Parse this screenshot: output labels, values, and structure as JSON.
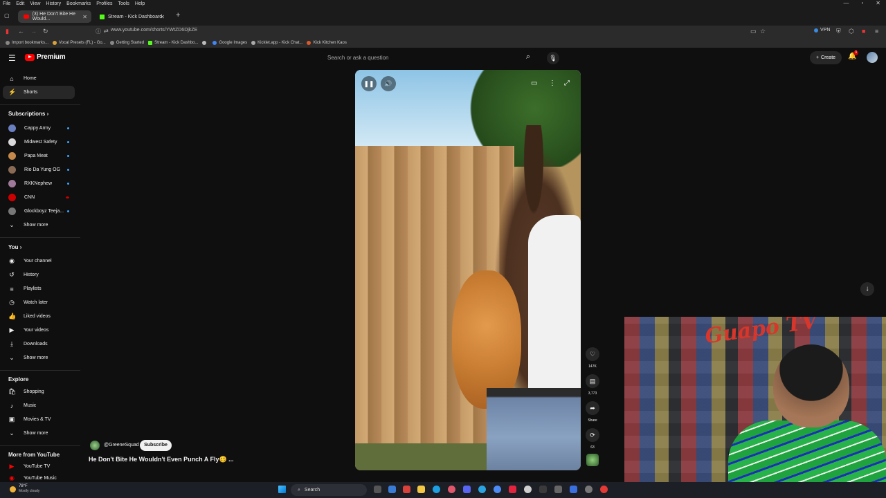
{
  "browser": {
    "menu": [
      "File",
      "Edit",
      "View",
      "History",
      "Bookmarks",
      "Profiles",
      "Tools",
      "Help"
    ],
    "tabs": [
      {
        "label": "(3) He Don't Bite He Would...",
        "active": true
      },
      {
        "label": "Stream - Kick Dashboard",
        "active": false
      }
    ],
    "new_tab": "+",
    "url": "www.youtube.com/shorts/YWtZD6DjkZE",
    "vpn_label": "VPN",
    "bookmarks": [
      "Import bookmarks...",
      "Vocal Presets (FL) - Go...",
      "Getting Started",
      "Stream - Kick Dashbo...",
      "",
      "Google Images",
      "Kicklet.app - Kick Chat...",
      "Kick Kitchen Kaos"
    ]
  },
  "header": {
    "logo_text": "Premium",
    "search_placeholder": "Search or ask a question",
    "create_label": "Create",
    "notification_count": "3"
  },
  "sidebar": {
    "main": [
      {
        "label": "Home",
        "icon": "home-icon"
      },
      {
        "label": "Shorts",
        "icon": "shorts-icon",
        "active": true
      }
    ],
    "subscriptions_title": "Subscriptions",
    "subscriptions": [
      {
        "label": "Cappy Army",
        "color": "#6a7fbf"
      },
      {
        "label": "Midwest Safety",
        "color": "#d9d9d9"
      },
      {
        "label": "Papa Meat",
        "color": "#c58a4b"
      },
      {
        "label": "Rio Da Yung OG",
        "color": "#8a6a55"
      },
      {
        "label": "RXKNephew",
        "color": "#a07a9a"
      },
      {
        "label": "CNN",
        "color": "#cc0000"
      },
      {
        "label": "Glockboyz Teeja...",
        "color": "#777777"
      }
    ],
    "show_more": "Show more",
    "you_title": "You",
    "you_items": [
      {
        "label": "Your channel",
        "icon": "account-icon"
      },
      {
        "label": "History",
        "icon": "history-icon"
      },
      {
        "label": "Playlists",
        "icon": "playlists-icon"
      },
      {
        "label": "Watch later",
        "icon": "clock-icon"
      },
      {
        "label": "Liked videos",
        "icon": "thumbs-up-icon"
      },
      {
        "label": "Your videos",
        "icon": "video-icon"
      },
      {
        "label": "Downloads",
        "icon": "download-icon"
      }
    ],
    "explore_title": "Explore",
    "explore_items": [
      {
        "label": "Shopping",
        "icon": "shopping-icon"
      },
      {
        "label": "Music",
        "icon": "music-icon"
      },
      {
        "label": "Movies & TV",
        "icon": "movies-icon"
      }
    ],
    "more_title": "More from YouTube",
    "more_items": [
      "YouTube TV",
      "YouTube Music"
    ]
  },
  "short": {
    "channel": "@GreeneSquad",
    "subscribe_label": "Subscribe",
    "title": "He Don't Bite He Wouldn't Even Punch A Fly🥴 ...",
    "likes": "147K",
    "comments": "3,773",
    "share_label": "Share",
    "remix_count": "63"
  },
  "webcam": {
    "logo_text": "Guapo TV"
  },
  "taskbar": {
    "temperature": "78°F",
    "condition": "Mostly cloudy",
    "search_label": "Search"
  }
}
